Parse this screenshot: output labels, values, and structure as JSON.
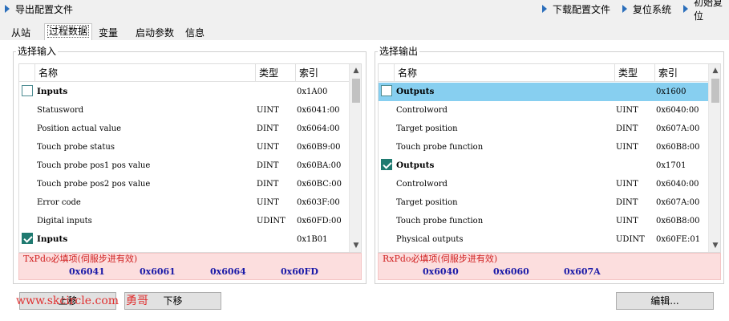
{
  "toolbar": {
    "export_config": "导出配置文件",
    "download_config": "下载配置文件",
    "reset_system": "复位系统",
    "initial_reset": "初始复位"
  },
  "tabs": [
    {
      "label": "从站"
    },
    {
      "label": "过程数据"
    },
    {
      "label": "变量"
    },
    {
      "label": "启动参数"
    },
    {
      "label": "信息"
    }
  ],
  "input_panel": {
    "title": "选择输入",
    "columns": {
      "name": "名称",
      "type": "类型",
      "index": "索引"
    },
    "rows": [
      {
        "name": "Inputs",
        "type": "",
        "index": "0x1A00"
      },
      {
        "name": "Statusword",
        "type": "UINT",
        "index": "0x6041:00"
      },
      {
        "name": "Position actual value",
        "type": "DINT",
        "index": "0x6064:00"
      },
      {
        "name": "Touch probe status",
        "type": "UINT",
        "index": "0x60B9:00"
      },
      {
        "name": "Touch probe pos1 pos value",
        "type": "DINT",
        "index": "0x60BA:00"
      },
      {
        "name": "Touch probe pos2 pos value",
        "type": "DINT",
        "index": "0x60BC:00"
      },
      {
        "name": "Error code",
        "type": "UINT",
        "index": "0x603F:00"
      },
      {
        "name": "Digital inputs",
        "type": "UDINT",
        "index": "0x60FD:00"
      },
      {
        "name": "Inputs",
        "type": "",
        "index": "0x1B01"
      }
    ],
    "required": {
      "title": "TxPdo必填项(伺服步进有效)",
      "codes": [
        "0x6041",
        "0x6061",
        "0x6064",
        "0x60FD"
      ]
    }
  },
  "output_panel": {
    "title": "选择输出",
    "columns": {
      "name": "名称",
      "type": "类型",
      "index": "索引"
    },
    "rows": [
      {
        "name": "Outputs",
        "type": "",
        "index": "0x1600"
      },
      {
        "name": "Controlword",
        "type": "UINT",
        "index": "0x6040:00"
      },
      {
        "name": "Target position",
        "type": "DINT",
        "index": "0x607A:00"
      },
      {
        "name": "Touch probe function",
        "type": "UINT",
        "index": "0x60B8:00"
      },
      {
        "name": "Outputs",
        "type": "",
        "index": "0x1701"
      },
      {
        "name": "Controlword",
        "type": "UINT",
        "index": "0x6040:00"
      },
      {
        "name": "Target position",
        "type": "DINT",
        "index": "0x607A:00"
      },
      {
        "name": "Touch probe function",
        "type": "UINT",
        "index": "0x60B8:00"
      },
      {
        "name": "Physical outputs",
        "type": "UDINT",
        "index": "0x60FE:01"
      }
    ],
    "required": {
      "title": "RxPdo必填项(伺服步进有效)",
      "codes": [
        "0x6040",
        "0x6060",
        "0x607A"
      ]
    }
  },
  "buttons": {
    "move_up": "上移",
    "move_down": "下移",
    "edit": "编辑..."
  },
  "watermark": {
    "url": "www.skcircle.com",
    "author": "勇哥"
  },
  "colors": {
    "selected_row": "#87cff0",
    "checkbox_checked": "#1f7a70",
    "required_bg": "#fcdede",
    "required_title": "#d02020",
    "required_code": "#1a1aa8",
    "toolbar_arrow": "#2a6ebb"
  }
}
